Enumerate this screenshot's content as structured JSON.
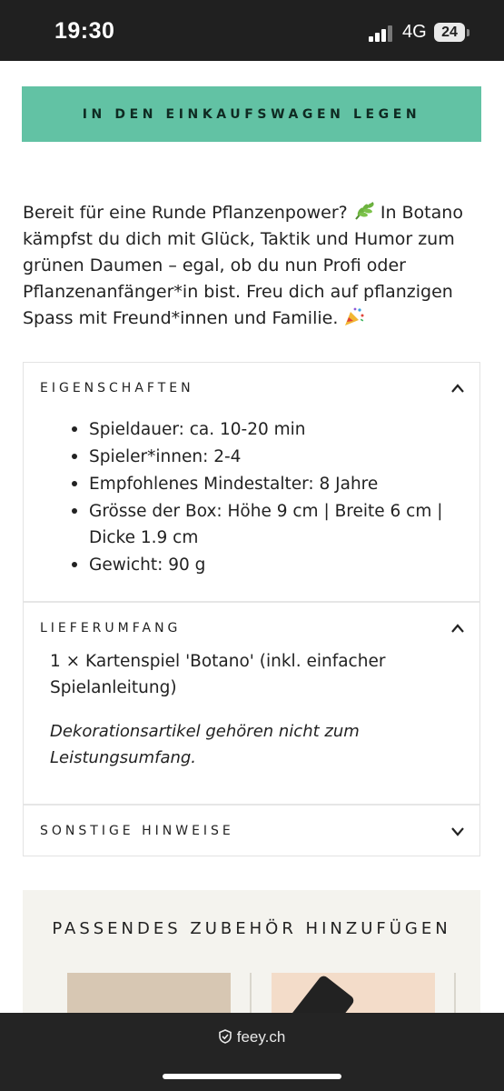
{
  "status_bar": {
    "time": "19:30",
    "network": "4G",
    "battery": "24"
  },
  "cta": {
    "label": "IN DEN EINKAUFSWAGEN LEGEN",
    "color": "#62c2a4"
  },
  "description": {
    "part1": "Bereit für eine Runde Pflanzenpower?",
    "part2": " In Botano kämpfst du dich mit Glück, Taktik und Humor zum grünen Daumen – egal, ob du nun Profi oder Pflanzenanfänger*in bist. Freu dich auf pflanzigen Spass mit Freund*innen und Familie.",
    "icons": [
      "leaf-emoji",
      "party-popper-emoji"
    ]
  },
  "accordion": {
    "eigenschaften": {
      "title": "EIGENSCHAFTEN",
      "expanded": true,
      "items": [
        "Spieldauer: ca. 10-20 min",
        "Spieler*innen: 2-4",
        "Empfohlenes Mindestalter: 8 Jahre",
        "Grösse der Box: Höhe 9 cm | Breite 6 cm | Dicke 1.9 cm",
        "Gewicht: 90 g"
      ]
    },
    "lieferumfang": {
      "title": "LIEFERUMFANG",
      "expanded": true,
      "text": "1 × Kartenspiel 'Botano' (inkl. einfacher Spielanleitung)",
      "note": "Dekorationsartikel gehören nicht zum Leistungsumfang."
    },
    "sonstige": {
      "title": "SONSTIGE HINWEISE",
      "expanded": false
    }
  },
  "accessories": {
    "heading": "PASSENDES ZUBEHÖR HINZUFÜGEN"
  },
  "browser": {
    "url": "feey.ch"
  }
}
